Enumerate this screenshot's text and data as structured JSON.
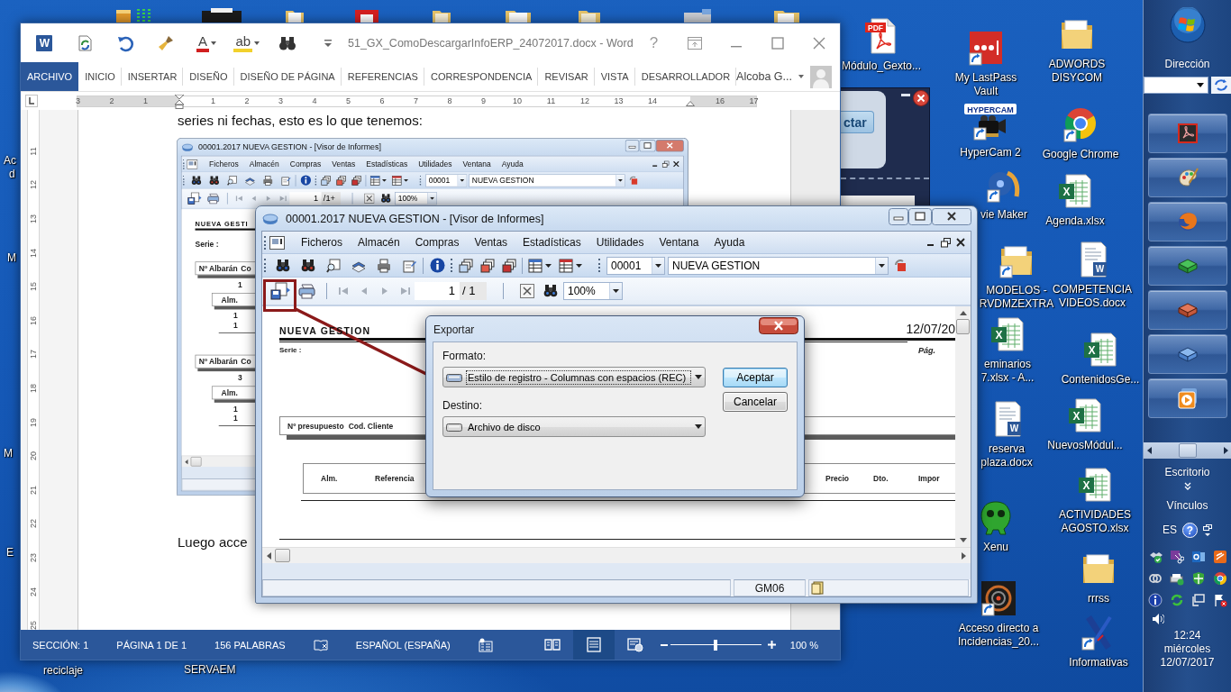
{
  "desktop": {
    "icons": [
      {
        "kind": "pdf",
        "badge": "PDF",
        "lines": [
          "Módulo_Gexto..."
        ],
        "shortcut": false
      },
      {
        "kind": "lastpass",
        "lines": [
          "My LastPass",
          "Vault"
        ],
        "shortcut": true
      },
      {
        "kind": "camera",
        "badge": "HYPERCAM",
        "lines": [
          "HyperCam 2"
        ],
        "shortcut": true
      },
      {
        "kind": "film",
        "lines": [
          "vie Maker"
        ],
        "shortcut": true
      },
      {
        "kind": "folder",
        "lines": [
          "MODELOS -",
          "RVDMZEXTRA"
        ],
        "shortcut": true
      },
      {
        "kind": "excel",
        "badge": "X",
        "lines": [
          "eminarios",
          "7.xlsx - A..."
        ],
        "shortcut": false
      },
      {
        "kind": "word",
        "badge": "W",
        "lines": [
          "reserva",
          "plaza.docx"
        ],
        "shortcut": false
      },
      {
        "kind": "creature",
        "lines": [
          "Xenu"
        ],
        "shortcut": false
      },
      {
        "kind": "photo",
        "lines": [
          "Acceso directo a",
          "Incidencias_20..."
        ],
        "shortcut": true
      },
      {
        "kind": "folder",
        "lines": [
          "ADWORDS",
          "DISYCOM"
        ],
        "shortcut": false
      },
      {
        "kind": "chrome",
        "lines": [
          "Google Chrome"
        ],
        "shortcut": true
      },
      {
        "kind": "excel",
        "badge": "X",
        "lines": [
          "Agenda.xlsx"
        ],
        "shortcut": false
      },
      {
        "kind": "word",
        "badge": "W",
        "lines": [
          "COMPETENCIA",
          "VIDEOS.docx"
        ],
        "shortcut": false
      },
      {
        "kind": "excel",
        "badge": "X",
        "lines": [
          "ContenidosGe..."
        ],
        "shortcut": false
      },
      {
        "kind": "excel",
        "badge": "X",
        "lines": [
          "NuevosMódul..."
        ],
        "shortcut": false
      },
      {
        "kind": "excel",
        "badge": "X",
        "lines": [
          "ACTIVIDADES",
          "AGOSTO.xlsx"
        ],
        "shortcut": false
      },
      {
        "kind": "folder",
        "lines": [
          "rrrss"
        ],
        "shortcut": false
      },
      {
        "kind": "aeat",
        "lines": [
          "Informativas"
        ],
        "shortcut": true
      }
    ],
    "partial_labels": [
      "Ac",
      "d",
      "M",
      "M",
      "E",
      "reciclaje",
      "SERVAEM"
    ]
  },
  "background_window": {
    "button": "ctar"
  },
  "word": {
    "quick_access": [
      {
        "kind": "logo",
        "glyph": "W"
      },
      {
        "kind": "sync"
      },
      {
        "kind": "undo"
      },
      {
        "kind": "brush"
      },
      {
        "kind": "font-color",
        "glyph": "A"
      },
      {
        "kind": "highlight",
        "glyph": "ab"
      },
      {
        "kind": "find"
      },
      {
        "kind": "customize"
      }
    ],
    "title": "51_GX_ComoDescargarInfoERP_24072017.docx - Word",
    "help": "?",
    "tabs": [
      {
        "kind": "file",
        "label": "ARCHIVO",
        "selected": false
      },
      {
        "kind": "tab",
        "label": "INICIO",
        "selected": false
      },
      {
        "kind": "tab",
        "label": "INSERTAR",
        "selected": false
      },
      {
        "kind": "tab",
        "label": "DISEÑO",
        "selected": false
      },
      {
        "kind": "tab",
        "label": "DISEÑO DE PÁGINA",
        "selected": false
      },
      {
        "kind": "tab",
        "label": "REFERENCIAS",
        "selected": false
      },
      {
        "kind": "tab",
        "label": "CORRESPONDENCIA",
        "selected": false
      },
      {
        "kind": "tab",
        "label": "REVISAR",
        "selected": false
      },
      {
        "kind": "tab",
        "label": "VISTA",
        "selected": false
      },
      {
        "kind": "tab",
        "label": "DESARROLLADOR",
        "selected": false
      }
    ],
    "user": "Alcoba G...",
    "ruler": {
      "horizontal": [
        "3",
        "2",
        "1",
        "1",
        "2",
        "3",
        "4",
        "5",
        "6",
        "7",
        "8",
        "9",
        "10",
        "11",
        "12",
        "13",
        "14",
        "16",
        "17"
      ],
      "vertical": [
        "11",
        "12",
        "13",
        "14",
        "15",
        "16",
        "17",
        "18",
        "19",
        "20",
        "21",
        "22",
        "23",
        "24",
        "25"
      ]
    },
    "document": {
      "paragraphs": [
        "series ni fechas, esto es lo que tenemos:",
        "Luego acce"
      ]
    },
    "status_bar": {
      "items": [
        "SECCIÓN: 1",
        "PÁGINA 1 DE 1",
        "156 PALABRAS"
      ],
      "language": "ESPAÑOL (ESPAÑA)",
      "views": [
        {
          "kind": "read",
          "selected": false
        },
        {
          "kind": "print",
          "selected": true
        },
        {
          "kind": "web",
          "selected": false
        }
      ],
      "zoom": {
        "level": 0.5,
        "reading": "100 %"
      }
    }
  },
  "screenshot": {
    "title": "00001.2017 NUEVA GESTION - [Visor de Informes]",
    "menu": [
      "Ficheros",
      "Almacén",
      "Compras",
      "Ventas",
      "Estadísticas",
      "Utilidades",
      "Ventana",
      "Ayuda"
    ],
    "code": "00001",
    "company": "NUEVA GESTION",
    "page": "1",
    "pages": "/1+",
    "zoom": "100%",
    "report": {
      "heading": "NUEVA GESTI",
      "serie": "Serie :",
      "groups": [
        {
          "header": [
            "Nº Albarán",
            "Co"
          ],
          "number": "1",
          "sub_header": "Alm.",
          "rows": [
            "1",
            "1"
          ]
        },
        {
          "header": [
            "Nº Albarán",
            "Co"
          ],
          "number": "3",
          "sub_header": "Alm.",
          "rows": [
            "1",
            "1"
          ]
        }
      ]
    }
  },
  "erp": {
    "title": "00001.2017 NUEVA GESTION - [Visor de Informes]",
    "menu": [
      "Ficheros",
      "Almacén",
      "Compras",
      "Ventas",
      "Estadísticas",
      "Utilidades",
      "Ventana",
      "Ayuda"
    ],
    "code": "00001",
    "company": "NUEVA GESTION",
    "page": "1",
    "pages": "/ 1",
    "zoom": "100%",
    "report": {
      "heading": "NUEVA GESTION",
      "date": "12/07/20",
      "serie": "Serie :",
      "page_label": "Pág.",
      "header": [
        "Nº presupuesto",
        "Cod. Cliente"
      ],
      "columns": [
        "Alm.",
        "Referencia",
        "Precio",
        "Dto.",
        "Impor"
      ]
    },
    "status": "GM06"
  },
  "dialog": {
    "title": "Exportar",
    "fields": [
      {
        "label": "Formato:",
        "value": "Estilo de registro - Columnas con espacios (REC)",
        "focused": true
      },
      {
        "label": "Destino:",
        "value": "Archivo de disco",
        "focused": false
      }
    ],
    "buttons": [
      {
        "label": "Aceptar",
        "default": true
      },
      {
        "label": "Cancelar",
        "default": false
      }
    ]
  },
  "taskbar": {
    "address_label": "Dirección",
    "desktop_label": "Escritorio",
    "links_label": "Vínculos",
    "language": "ES",
    "help": "?",
    "time": "12:24",
    "day": "miércoles",
    "date": "12/07/2017"
  }
}
